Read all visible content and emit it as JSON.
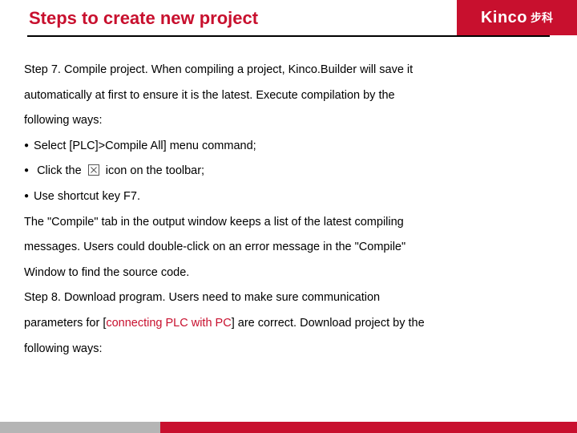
{
  "header": {
    "title": "Steps to create new project",
    "logo_main": "Kinco",
    "logo_cn": "步科"
  },
  "body": {
    "p1": "Step 7. Compile project. When compiling a project, Kinco.Builder will save it",
    "p2": "automatically at first to ensure it is the latest. Execute compilation by the",
    "p3": "following ways:",
    "b1": "Select [PLC]>Compile All] menu command;",
    "b2a": "Click the",
    "b2b": "icon on the toolbar;",
    "b3": "Use shortcut key F7.",
    "p4": "The \"Compile\" tab in the output window keeps a list of the latest compiling",
    "p5": "messages. Users could double-click on an error message in the \"Compile\"",
    "p6": "Window to find the source code.",
    "p7a": "Step 8. Download program. Users need to make sure communication",
    "p8a": "parameters for [",
    "p8_link": "connecting PLC with PC",
    "p8b": "] are correct. Download project by the",
    "p9": "following ways:"
  }
}
